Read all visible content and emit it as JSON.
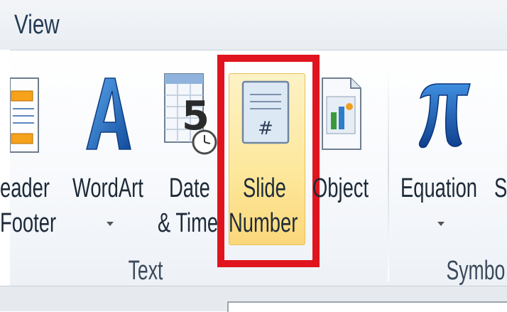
{
  "tab": {
    "label": "View"
  },
  "groups": {
    "text": {
      "label": "Text",
      "buttons": {
        "header_footer": {
          "line1": "eader",
          "line2": "Footer"
        },
        "wordart": {
          "line1": "WordArt"
        },
        "date_time": {
          "line1": "Date",
          "line2": "& Time"
        },
        "slide_number": {
          "line1": "Slide",
          "line2": "Number"
        },
        "object": {
          "line1": "Object"
        }
      }
    },
    "symbols": {
      "label": "Symbo",
      "buttons": {
        "equation": {
          "line1": "Equation"
        },
        "symbol_cut": {
          "line1": "S"
        }
      }
    }
  },
  "date_icon_digit": "5",
  "slide_icon_glyph": "#",
  "colors": {
    "highlight": "#e0141e",
    "slide_button_bg": "#fde79a",
    "wordart_blue": "#1c6fc0",
    "pi_blue": "#1b5fb5"
  }
}
